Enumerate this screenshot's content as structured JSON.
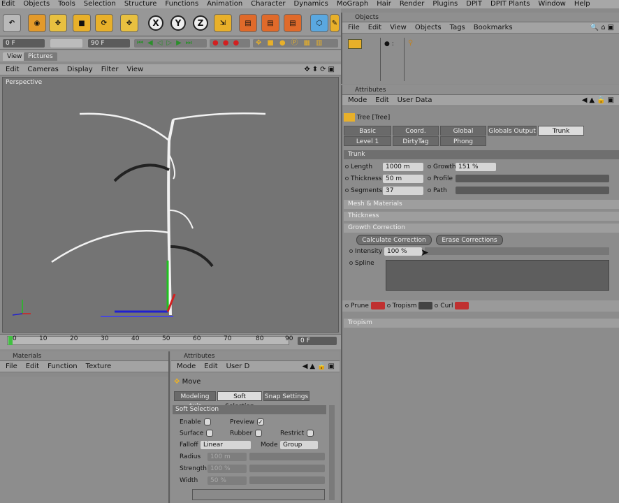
{
  "menubar": [
    "Edit",
    "Objects",
    "Tools",
    "Selection",
    "Structure",
    "Functions",
    "Animation",
    "Character",
    "Dynamics",
    "MoGraph",
    "Hair",
    "Render",
    "Plugins",
    "DPIT",
    "DPIT Plants",
    "Window",
    "Help"
  ],
  "timebar": {
    "current": "0 F",
    "end": "90 F"
  },
  "view_tabs": [
    "View",
    "Pictures"
  ],
  "view_menu": [
    "Edit",
    "Cameras",
    "Display",
    "Filter",
    "View"
  ],
  "viewport": {
    "label": "Perspective"
  },
  "timeline": {
    "ticks": [
      "0",
      "10",
      "20",
      "30",
      "40",
      "50",
      "60",
      "70",
      "80",
      "90"
    ],
    "frame_field": "0 F"
  },
  "materials": {
    "title": "Materials",
    "menu": [
      "File",
      "Edit",
      "Function",
      "Texture"
    ]
  },
  "objects": {
    "title": "Objects",
    "menu": [
      "File",
      "Edit",
      "View",
      "Objects",
      "Tags",
      "Bookmarks"
    ]
  },
  "attributes": {
    "title": "Attributes",
    "menu": [
      "Mode",
      "Edit",
      "User Data"
    ],
    "object_name": "Tree [Tree]",
    "tabs_row1": [
      "Basic",
      "Coord.",
      "Global",
      "Globals Output",
      "Trunk"
    ],
    "tabs_row2": [
      "Level 1",
      "DirtyTag",
      "Phong"
    ],
    "section": "Trunk",
    "params": {
      "length_label": "Length",
      "length_value": "1000 m",
      "growth_label": "Growth",
      "growth_value": "151 %",
      "thickness_label": "Thickness",
      "thickness_value": "50 m",
      "profile_label": "Profile",
      "segments_label": "Segments",
      "segments_value": "37",
      "path_label": "Path"
    },
    "groups": [
      "Mesh & Materials",
      "Thickness",
      "Growth Correction"
    ],
    "calc_button": "Calculate Correction",
    "erase_button": "Erase Corrections",
    "intensity_label": "Intensity",
    "intensity_value": "100 %",
    "intensity_fraction": 1.0,
    "spline_label": "Spline",
    "tags": {
      "prune": "Prune",
      "tropism": "Tropism",
      "curl": "Curl"
    },
    "tropism_group": "Tropism"
  },
  "attr2": {
    "title": "Attributes",
    "menu": [
      "Mode",
      "Edit",
      "User D"
    ],
    "tool": "Move",
    "tabs": [
      "Modeling Axis",
      "Soft Selection",
      "Snap Settings"
    ],
    "section": "Soft Selection",
    "enable": "Enable",
    "preview": "Preview",
    "surface": "Surface",
    "rubber": "Rubber",
    "restrict": "Restrict",
    "falloff_label": "Falloff",
    "falloff_value": "Linear",
    "mode_label": "Mode",
    "mode_value": "Group",
    "radius_label": "Radius",
    "radius_value": "100 m",
    "strength_label": "Strength",
    "strength_value": "100 %",
    "width_label": "Width",
    "width_value": "50 %"
  },
  "colors": {
    "accent": "#e8b02a",
    "ui_bg": "#8c8c8c",
    "axis_x": "#d22020",
    "axis_y": "#20c020",
    "axis_z": "#2020d0"
  }
}
